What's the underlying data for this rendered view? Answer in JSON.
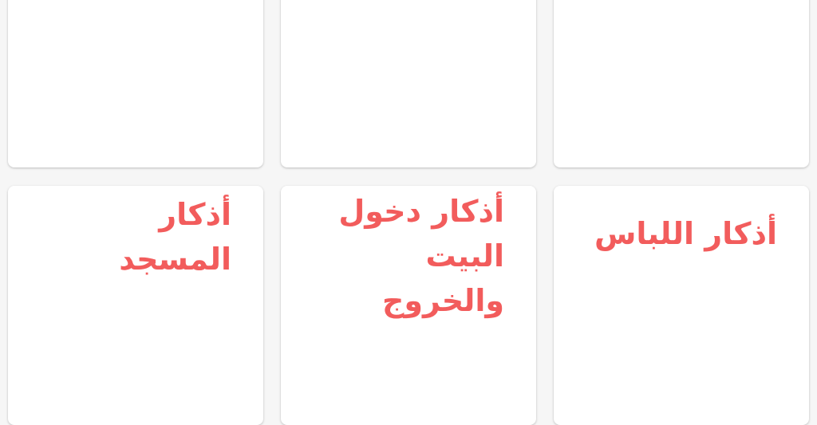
{
  "cards": [
    {
      "title": ""
    },
    {
      "title": ""
    },
    {
      "title": ""
    },
    {
      "title": "أذكار\nالمسجد"
    },
    {
      "title": "أذكار دخول\nالبيت\nوالخروج"
    },
    {
      "title": "أذكار اللباس"
    }
  ],
  "colors": {
    "accent": "#f25c5c",
    "background": "#f6f6f6",
    "card": "#ffffff"
  }
}
